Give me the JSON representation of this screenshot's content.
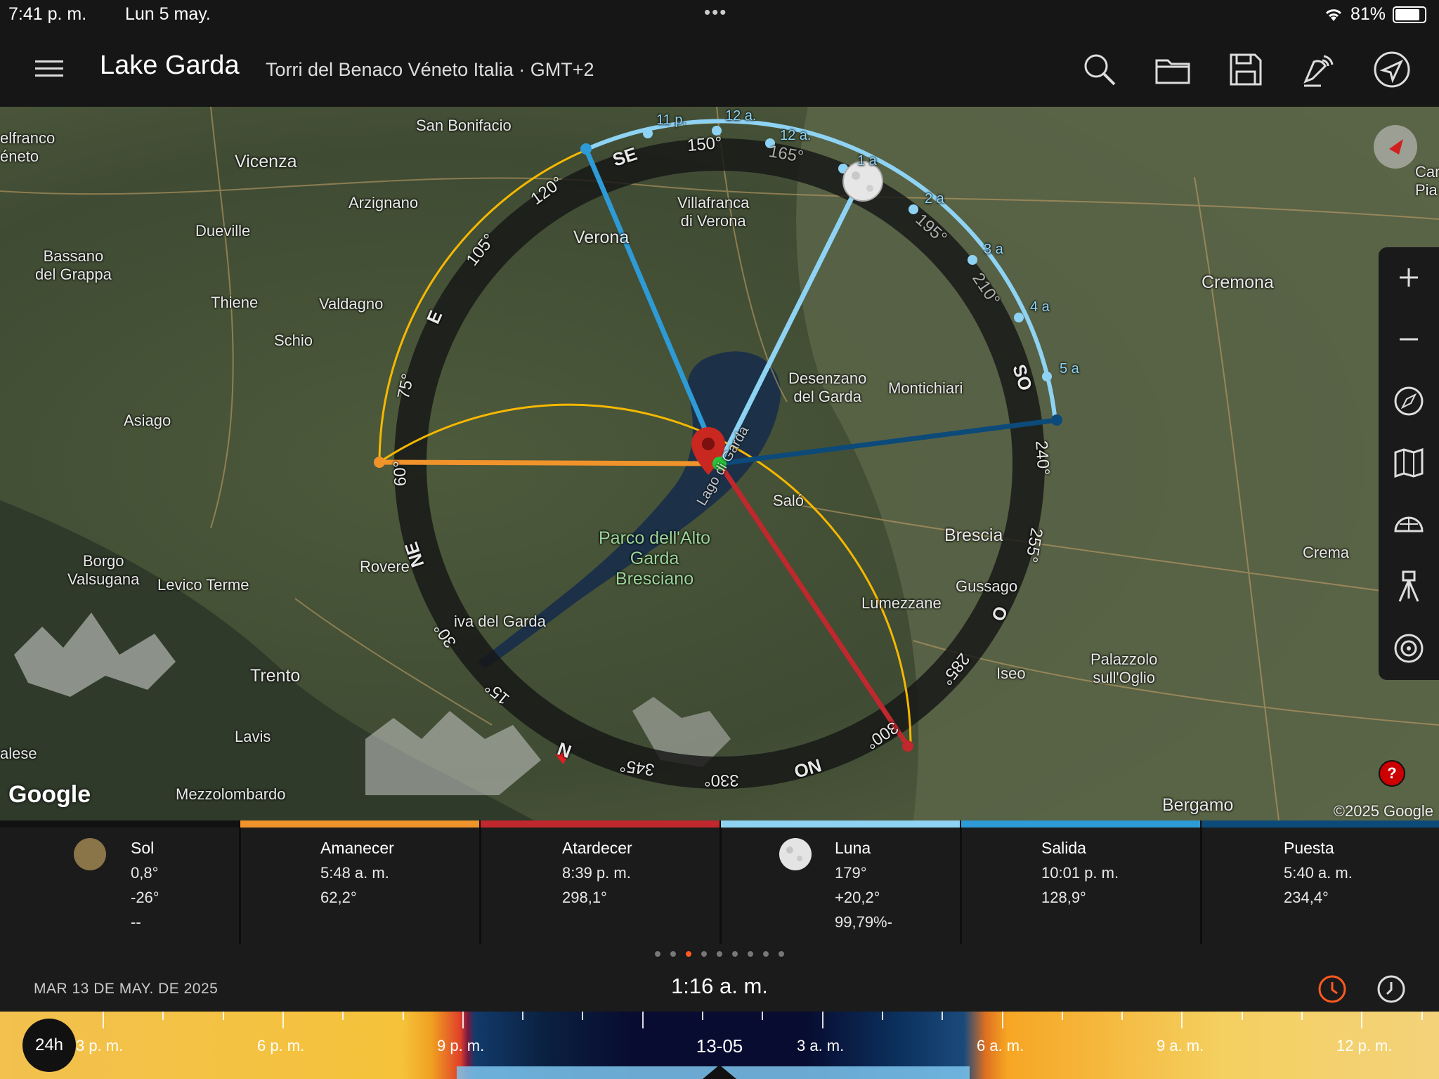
{
  "status": {
    "time": "7:41 p. m.",
    "date": "Lun 5 may.",
    "more": "•••",
    "battery": "81%"
  },
  "header": {
    "title": "Lake Garda",
    "subtitle": "Torri del Benaco Véneto Italia · GMT+2",
    "icons": [
      "search-icon",
      "folder-icon",
      "save-icon",
      "satellite-icon",
      "navigate-icon"
    ]
  },
  "map": {
    "labels": [
      "San Bonifacio",
      "Vicenza",
      "Arzignano",
      "Dueville",
      "Bassano\ndel Grappa",
      "Thiene",
      "Valdagno",
      "Schio",
      "Asiago",
      "Villafranca\ndi Verona",
      "Verona",
      "Desenzano\ndel Garda",
      "Montichiari",
      "Cremona",
      "Saló",
      "Brescia",
      "Gussago",
      "Lumezzane",
      "Crema",
      "Palazzolo\nsull'Oglio",
      "Iseo",
      "Bergamo",
      "Borgo\nValsugana",
      "Levico Terme",
      "Rovere",
      "iva del Garda",
      "Trento",
      "Lavis",
      "Mezzolombardo",
      "elfranco\néneto",
      "alese",
      "Car\nPia",
      "Lago di Garda"
    ],
    "park": "Parco dell'Alto\nGarda\nBresciano",
    "google": "Google",
    "copyright": "©2025 Google",
    "help": "?",
    "dial_marks": [
      "SE",
      "150°",
      "165°",
      "120°",
      "105°",
      "E",
      "75°",
      "60°",
      "NE",
      "30°",
      "15°",
      "N",
      "345°",
      "330°",
      "NO",
      "300°",
      "285°",
      "O",
      "255°",
      "240°",
      "SO",
      "210°",
      "195°"
    ],
    "moon_hours": [
      "11 p.",
      "12 a.",
      "12 a.",
      "1 a",
      "2 a",
      "3 a",
      "4 a",
      "5 a"
    ]
  },
  "sidebar_tools": [
    "zoom-in-icon",
    "zoom-out-icon",
    "compass-icon",
    "map-icon",
    "globe-grid-icon",
    "tripod-icon",
    "target-icon"
  ],
  "info": [
    {
      "label": "Sol",
      "lines": [
        "0,8°",
        "-26°",
        "--"
      ],
      "color": "#111111"
    },
    {
      "label": "Amanecer",
      "lines": [
        "5:48 a. m.",
        "62,2°"
      ],
      "color": "#f0932b"
    },
    {
      "label": "Atardecer",
      "lines": [
        "8:39 p. m.",
        "298,1°"
      ],
      "color": "#c0282d"
    },
    {
      "label": "Luna",
      "lines": [
        "179°",
        "+20,2°",
        "99,79%-"
      ],
      "color": "#8fd3f4"
    },
    {
      "label": "Salida",
      "lines": [
        "10:01 p. m.",
        "128,9°"
      ],
      "color": "#2e9bd6"
    },
    {
      "label": "Puesta",
      "lines": [
        "5:40 a. m.",
        "234,4°"
      ],
      "color": "#0c4a7a"
    }
  ],
  "pager": {
    "count": 9,
    "active": 2
  },
  "datebar": {
    "date": "MAR 13 DE MAY. DE 2025",
    "time": "1:16 a. m."
  },
  "timeline": {
    "badge": "24h",
    "center": "13-05",
    "labels": [
      "3 p. m.",
      "6 p. m.",
      "9 p. m.",
      "3 a. m.",
      "6 a. m.",
      "9 a. m.",
      "12 p. m."
    ]
  }
}
